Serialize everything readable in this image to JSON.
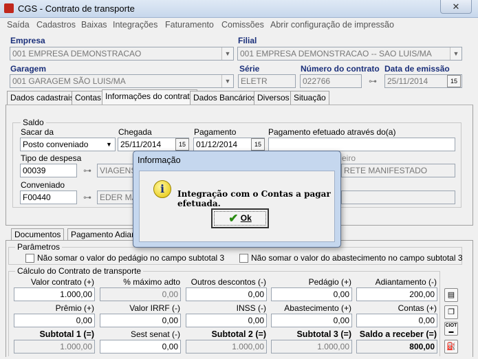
{
  "window": {
    "title": "CGS - Contrato de transporte",
    "close": "✕"
  },
  "menu": [
    "Saída",
    "Cadastros",
    "Baixas",
    "Integrações",
    "Faturamento",
    "Comissões",
    "Abrir configuração de impressão"
  ],
  "header": {
    "empresa_label": "Empresa",
    "empresa_value": "001 EMPRESA DEMONSTRACAO",
    "filial_label": "Filial",
    "filial_value": "001 EMPRESA DEMONSTRACAO -- SAO LUIS/MA",
    "garagem_label": "Garagem",
    "garagem_value": "001 GARAGEM SÃO LUIS/MA",
    "serie_label": "Série",
    "serie_value": "ELETR",
    "numero_label": "Número do contrato",
    "numero_value": "022766",
    "data_label": "Data de emissão",
    "data_value": "25/11/2014"
  },
  "tabs": [
    "Dados cadastrais",
    "Contas",
    "Informações do contrato",
    "Dados Bancários",
    "Diversos",
    "Situação"
  ],
  "saldo": {
    "title": "Saldo",
    "sacar_label": "Sacar da",
    "sacar_value": "Posto conveniado",
    "chegada_label": "Chegada",
    "chegada_value": "25/11/2014",
    "pagamento_label": "Pagamento",
    "pagamento_value": "01/12/2014",
    "efetuado_label": "Pagamento efetuado através do(a)",
    "tipo_label": "Tipo de despesa",
    "tipo_code": "00039",
    "tipo_desc": "VIAGENS",
    "partial_label": "eiro",
    "frete_desc": "RETE MANIFESTADO",
    "conveniado_label": "Conveniado",
    "conveniado_code": "F00440",
    "conveniado_desc": "EDER MA"
  },
  "subtabs": [
    "Documentos",
    "Pagamento Adian"
  ],
  "parametros": {
    "title": "Parâmetros",
    "cb1": "Não somar o valor do pedágio no campo subtotal 3",
    "cb2": "Não somar o valor do abastecimento no campo subtotal 3"
  },
  "calculo": {
    "title": "Cálculo do Contrato de transporte",
    "row1": [
      {
        "label": "Valor contrato (+)",
        "value": "1.000,00"
      },
      {
        "label": "% máximo adto",
        "value": "0,00"
      },
      {
        "label": "Outros descontos (-)",
        "value": "0,00"
      },
      {
        "label": "Pedágio (+)",
        "value": "0,00"
      },
      {
        "label": "Adiantamento (-)",
        "value": "200,00"
      }
    ],
    "row2": [
      {
        "label": "Prêmio (+)",
        "value": "0,00"
      },
      {
        "label": "Valor IRRF (-)",
        "value": "0,00"
      },
      {
        "label": "INSS (-)",
        "value": "0,00"
      },
      {
        "label": "Abastecimento (+)",
        "value": "0,00"
      },
      {
        "label": "Contas (+)",
        "value": "0,00"
      }
    ],
    "row3": [
      {
        "label": "Subtotal 1 (=)",
        "value": "1.000,00"
      },
      {
        "label": "Sest senat (-)",
        "value": "0,00"
      },
      {
        "label": "Subtotal 2 (=)",
        "value": "1.000,00"
      },
      {
        "label": "Subtotal 3 (=)",
        "value": "1.000,00"
      },
      {
        "label": "Saldo a receber (=)",
        "value": "800,00"
      }
    ]
  },
  "dialog": {
    "title": "Informação",
    "message": "Integração com o Contas a pagar efetuada.",
    "ok_label": "Ok"
  }
}
